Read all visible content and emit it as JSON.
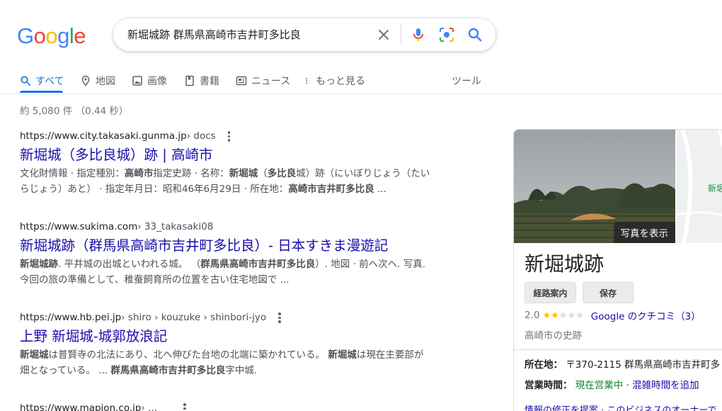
{
  "logo": {
    "letters": [
      "G",
      "o",
      "o",
      "g",
      "l",
      "e"
    ],
    "colors": [
      "#4285f4",
      "#ea4335",
      "#fbbc05",
      "#4285f4",
      "#34a853",
      "#ea4335"
    ]
  },
  "search": {
    "query": "新堀城跡 群馬県高崎市吉井町多比良"
  },
  "tabs": [
    {
      "label": "すべて",
      "icon": "search-icon",
      "active": true
    },
    {
      "label": "地図",
      "icon": "map-pin-icon"
    },
    {
      "label": "画像",
      "icon": "image-icon"
    },
    {
      "label": "書籍",
      "icon": "book-icon"
    },
    {
      "label": "ニュース",
      "icon": "news-icon"
    },
    {
      "label": "もっと見る",
      "icon": "more-vert-icon"
    }
  ],
  "tools_label": "ツール",
  "stats": "約 5,080 件 （0.44 秒）",
  "results": [
    {
      "site": "https://www.city.takasaki.gunma.jp",
      "path": " › docs",
      "title": "新堀城（多比良城）跡 | 高崎市",
      "snippet_line1": [
        "文化財情報 · 指定種別：",
        "高崎市",
        "指定史跡 · 名称：",
        "新堀城",
        "（",
        "多比良",
        "城）跡（にいぼりじょう（たい"
      ],
      "snippet_line2": [
        "らじょう）あと） · 指定年月日：昭和46年6月29日 · 所在地：",
        "高崎市吉井町多比良",
        " ..."
      ]
    },
    {
      "site": "https://www.sukima.com",
      "path": " › 33_takasaki08",
      "title": "新堀城跡（群馬県高崎市吉井町多比良）- 日本すきま漫遊記",
      "snippet_line1": [
        "新堀城跡",
        ". 平井城の出城といわれる城。 （",
        "群馬県高崎市吉井町多比良",
        "）. 地図 · 前へ次へ. 写真."
      ],
      "snippet_line2": [
        "今回の旅の準備として、稚蚕飼育所の位置を古い住宅地図で ..."
      ]
    },
    {
      "site": "https://www.hb.pei.jp",
      "path": " › shiro › kouzuke › shinbori-jyo",
      "title": "上野 新堀城-城郭放浪記",
      "snippet_line1": [
        "新堀城",
        "は普賢寺の北法にあり、北へ伸びた台地の北端に築かれている。 ",
        "新堀城",
        "は現在主要部が"
      ],
      "snippet_line2": [
        "畑となっている。 ... ",
        "群馬県高崎市吉井町多比良",
        "字中城."
      ]
    },
    {
      "site": "https://www.mapion.co.jp",
      "path": " › ..."
    }
  ],
  "knowledge_panel": {
    "photo_button": "写真を表示",
    "map_label": "新堀",
    "title": "新堀城跡",
    "directions_button": "経路案内",
    "save_button": "保存",
    "rating": "2.0",
    "stars": 2,
    "stars_max": 5,
    "reviews_link": "Google のクチコミ（3）",
    "category": "高崎市の史跡",
    "address_label": "所在地：",
    "address": "〒370-2115 群馬県高崎市吉井町多",
    "hours_label": "営業時間：",
    "hours_status": "現在営業中",
    "hours_separator": " · ",
    "busy_link": "混雑時間を追加",
    "cut_text": "情報の修正を提案 · このビジネスのオーナーで"
  }
}
